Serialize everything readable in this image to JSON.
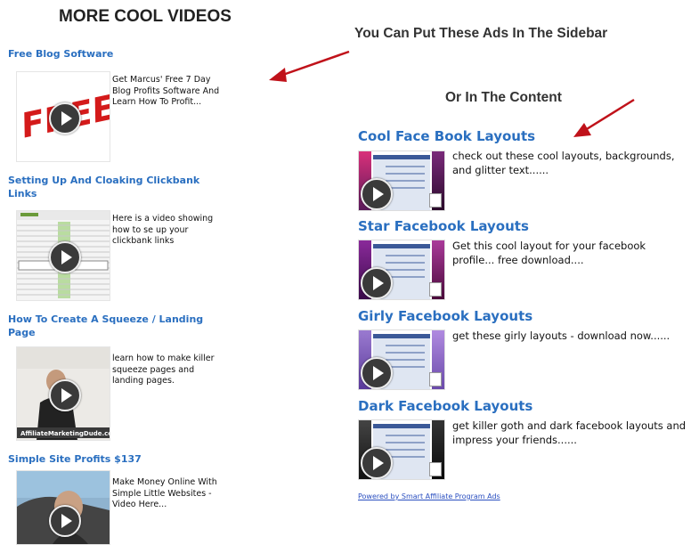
{
  "sidebar": {
    "title": "MORE COOL VIDEOS",
    "items": [
      {
        "title": "Free Blog Software",
        "desc": "Get Marcus' Free 7 Day Blog Profits Software And Learn How To Profit...",
        "thumb": "free-stamp-thumbnail"
      },
      {
        "title": "Setting Up And Cloaking Clickbank Links",
        "desc": "Here is a video showing how to se up your clickbank links",
        "thumb": "spreadsheet-thumbnail"
      },
      {
        "title": "How To Create A Squeeze / Landing Page",
        "desc": "learn how to make killer squeeze pages and landing pages.",
        "thumb": "presenter-thumbnail",
        "watermark": "AffiliateMarketingDude.com"
      },
      {
        "title": "Simple Site Profits $137",
        "desc": "Make Money Online With Simple Little Websites - Video Here...",
        "thumb": "car-driver-thumbnail"
      }
    ],
    "free_stamp_text": "FREE!"
  },
  "notes": {
    "sidebar_note": "You Can Put These Ads In The Sidebar",
    "content_note": "Or In The Content"
  },
  "content": {
    "items": [
      {
        "title": "Cool Face Book Layouts",
        "desc": "check out these cool layouts, backgrounds, and glitter text......"
      },
      {
        "title": "Star Facebook Layouts",
        "desc": "Get this cool layout for your facebook profile... free download...."
      },
      {
        "title": "Girly Facebook Layouts",
        "desc": "get these girly layouts - download now......"
      },
      {
        "title": "Dark Facebook Layouts",
        "desc": "get killer goth and dark facebook layouts and impress your friends......"
      }
    ],
    "powered_by": "Powered by Smart Affiliate Program Ads"
  },
  "colors": {
    "link_blue": "#2a6fc0",
    "arrow_red": "#c0121a"
  }
}
